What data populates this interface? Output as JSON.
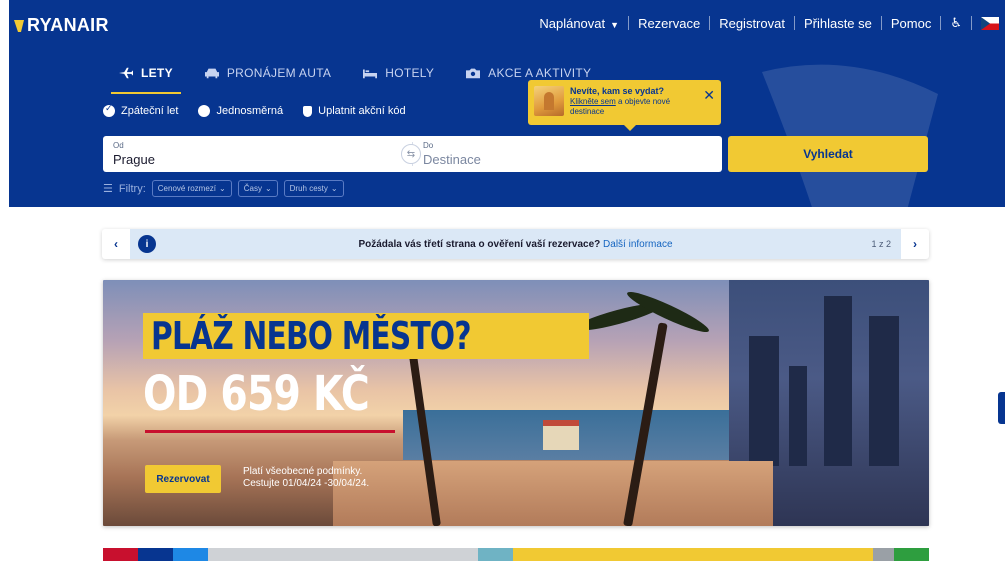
{
  "brand": {
    "logo_text": "RYANAIR",
    "primary": "#073590",
    "accent": "#f1c933"
  },
  "topnav": {
    "items": [
      "Naplánovat",
      "Rezervace",
      "Registrovat",
      "Přihlaste se",
      "Pomoc"
    ],
    "accessibility_icon": "accessibility-icon",
    "language_flag": "czech-flag"
  },
  "tabs": [
    {
      "label": "LETY",
      "icon": "plane-icon",
      "active": true
    },
    {
      "label": "PRONÁJEM AUTA",
      "icon": "car-icon",
      "active": false
    },
    {
      "label": "HOTELY",
      "icon": "bed-icon",
      "active": false
    },
    {
      "label": "AKCE A AKTIVITY",
      "icon": "camera-icon",
      "active": false
    }
  ],
  "trip_options": {
    "return_label": "Zpáteční let",
    "oneway_label": "Jednosměrná",
    "promo_label": "Uplatnit akční kód"
  },
  "search": {
    "from_label": "Od",
    "from_value": "Prague",
    "to_label": "Do",
    "to_placeholder": "Destinace",
    "button_label": "Vyhledat"
  },
  "filters": {
    "label": "Filtry:",
    "chips": [
      "Cenové rozmezí",
      "Časy",
      "Druh cesty"
    ]
  },
  "tooltip": {
    "title": "Nevíte, kam se vydat?",
    "link_text": "Klikněte sem",
    "rest_text": " a objevte nové destinace"
  },
  "notice": {
    "text": "Požádala vás třetí strana o ověření vaší rezervace?",
    "link": "Další informace",
    "counter": "1 z 2"
  },
  "banner": {
    "headline_1": "PLÁŽ NEBO MĚSTO?",
    "headline_2": "OD 659 KČ",
    "button_label": "Rezervovat",
    "terms_line_1": "Platí všeobecné podmínky.",
    "terms_line_2": "Cestujte 01/04/24 -30/04/24."
  }
}
